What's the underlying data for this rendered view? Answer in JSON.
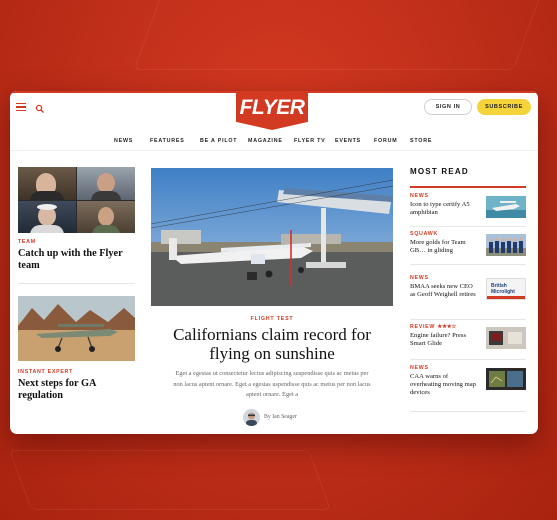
{
  "brand": {
    "logo_text": "FLYER",
    "accent": "#d23a22",
    "highlight": "#f5d33a"
  },
  "header": {
    "menu_icon": "hamburger-icon",
    "search_icon": "search-icon",
    "sign_in_label": "SIGN IN",
    "subscribe_label": "SUBSCRIBE"
  },
  "nav": {
    "items": [
      "NEWS",
      "FEATURES",
      "BE A PILOT",
      "MAGAZINE",
      "FLYER TV",
      "EVENTS",
      "FORUM",
      "STORE"
    ]
  },
  "left": {
    "story1": {
      "kicker": "TEAM",
      "title": "Catch up with the Flyer team"
    },
    "story2": {
      "kicker": "INSTANT EXPERT",
      "title": "Next steps for GA regulation"
    }
  },
  "hero": {
    "kicker": "FLIGHT TEST",
    "title": "Californians claim record for flying on sunshine",
    "summary": "Eget a egestas ut consectetur lectus adipiscing suspendisse quis ac metus per non lacus aptent ornare. Eget a egestas uspendisse quis ac metus per non lacus aptent ornare. Eget a",
    "byline": "By Ian Seager"
  },
  "most_read": {
    "heading": "MOST READ",
    "items": [
      {
        "kicker": "NEWS",
        "title": "Icon to type certify A5 amphibian"
      },
      {
        "kicker": "SQUAWK",
        "title": "More golds for Team GB… in gliding"
      },
      {
        "kicker": "NEWS",
        "title": "BMAA seeks new CEO as Geoff Weighell retires",
        "thumb_text": "British Microlight"
      },
      {
        "kicker": "REVIEW",
        "stars": "★★★☆",
        "title": "Engine failure? Press Smart Glide"
      },
      {
        "kicker": "NEWS",
        "title": "CAA warns of overheating moving map devices"
      }
    ]
  }
}
